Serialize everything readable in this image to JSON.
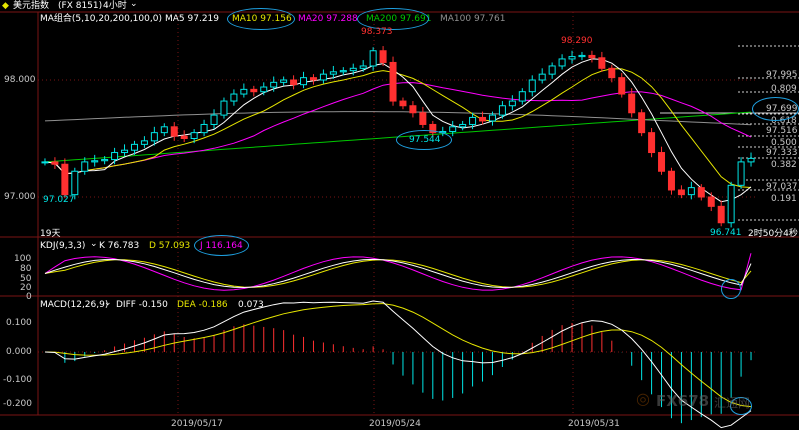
{
  "title": {
    "symbol_name": "美元指数",
    "symbol_code": "(FX 8151)",
    "period": "4小时",
    "period_arrow": "⌄"
  },
  "colors": {
    "background": "#000000",
    "grid": "#7a1414",
    "up_candle": "#00e6e6",
    "down_candle": "#ff3030",
    "ma5": "#ffffff",
    "ma10": "#e6e600",
    "ma20": "#ff00ff",
    "ma200": "#00c800",
    "ma100": "#909090",
    "highlight": "#1ea0e0",
    "axis_text": "#c8c8c8"
  },
  "main_legend": {
    "combo": "MA组合(5,10,20,200,100,0)",
    "ma5": "MA5 97.219",
    "ma10": "MA10 97.156",
    "ma20": "MA20 97.288",
    "ma200": "MA200 97.691",
    "ma100": "MA100 97.761"
  },
  "price_axis": {
    "tick_98": "98.000",
    "tick_97": "97.000"
  },
  "fib_levels": [
    "97.995",
    "0.809",
    "97.699",
    "0.618",
    "97.516",
    "0.500",
    "97.333",
    "0.382",
    "97.037",
    "0.191"
  ],
  "annotations": {
    "high_1": "98.373",
    "high_2": "98.290",
    "low_1": "97.544",
    "low_start": "97.027",
    "low_end": "96.741",
    "bar_count": "19天",
    "countdown": "2时50分4秒"
  },
  "kdj": {
    "label": "KDJ(9,3,3)",
    "k": "K 76.783",
    "d": "D 57.093",
    "j": "J 116.164",
    "axis": [
      "100",
      "80",
      "50",
      "20",
      "0"
    ]
  },
  "macd": {
    "label": "MACD(12,26,9)",
    "diff": "DIFF -0.150",
    "dea": "DEA -0.186",
    "value": "0.073",
    "axis": [
      "0.100",
      "0.000",
      "-0.100",
      "-0.200"
    ]
  },
  "dates": [
    "2019/05/17",
    "2019/05/24",
    "2019/05/31"
  ],
  "watermark": {
    "brand": "FX678",
    "suffix": "汇通网"
  },
  "chart_data": {
    "type": "candlestick",
    "price_range": [
      96.74,
      98.37
    ],
    "price_path": [
      97.3,
      97.28,
      97.02,
      97.22,
      97.3,
      97.31,
      97.32,
      97.38,
      97.4,
      97.45,
      97.48,
      97.55,
      97.6,
      97.52,
      97.5,
      97.55,
      97.62,
      97.7,
      97.82,
      97.88,
      97.92,
      97.9,
      97.94,
      97.98,
      98.0,
      97.96,
      98.02,
      98.0,
      98.05,
      98.07,
      98.08,
      98.1,
      98.12,
      98.25,
      98.15,
      97.82,
      97.78,
      97.72,
      97.62,
      97.55,
      97.56,
      97.6,
      97.62,
      97.68,
      97.65,
      97.7,
      97.78,
      97.82,
      97.9,
      98.0,
      98.05,
      98.12,
      98.18,
      98.2,
      98.21,
      98.19,
      98.1,
      98.02,
      97.88,
      97.72,
      97.55,
      97.38,
      97.22,
      97.06,
      97.02,
      97.08,
      97.0,
      96.92,
      96.78,
      97.1,
      97.3,
      97.33
    ]
  }
}
